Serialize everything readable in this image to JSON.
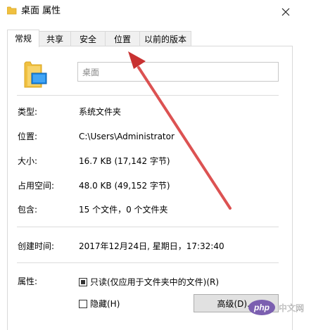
{
  "window": {
    "title": "桌面 属性",
    "close_glyph": "✕"
  },
  "tabs": [
    {
      "label": "常规",
      "active": true
    },
    {
      "label": "共享",
      "active": false
    },
    {
      "label": "安全",
      "active": false
    },
    {
      "label": "位置",
      "active": false
    },
    {
      "label": "以前的版本",
      "active": false
    }
  ],
  "name_field": {
    "value": "桌面"
  },
  "info": {
    "type_label": "类型:",
    "type_value": "系统文件夹",
    "location_label": "位置:",
    "location_value": "C:\\Users\\Administrator",
    "size_label": "大小:",
    "size_value": "16.7 KB (17,142 字节)",
    "disk_size_label": "占用空间:",
    "disk_size_value": "48.0 KB (49,152 字节)",
    "contains_label": "包含:",
    "contains_value": "15 个文件，0 个文件夹",
    "created_label": "创建时间:",
    "created_value": "2017年12月24日, 星期日，17:32:40"
  },
  "attributes": {
    "label": "属性:",
    "readonly_label": "只读(仅应用于文件夹中的文件)(R)",
    "readonly_checked": true,
    "hidden_label": "隐藏(H)",
    "hidden_checked": false,
    "advanced_button": "高级(D)..."
  },
  "watermark": {
    "text": "php 中文网"
  },
  "colors": {
    "folder": "#f0c040",
    "folder_dark": "#d9a520",
    "badge_blue": "#1e88e5",
    "arrow_red": "#d94040",
    "watermark_purple": "#7b5fb0"
  }
}
